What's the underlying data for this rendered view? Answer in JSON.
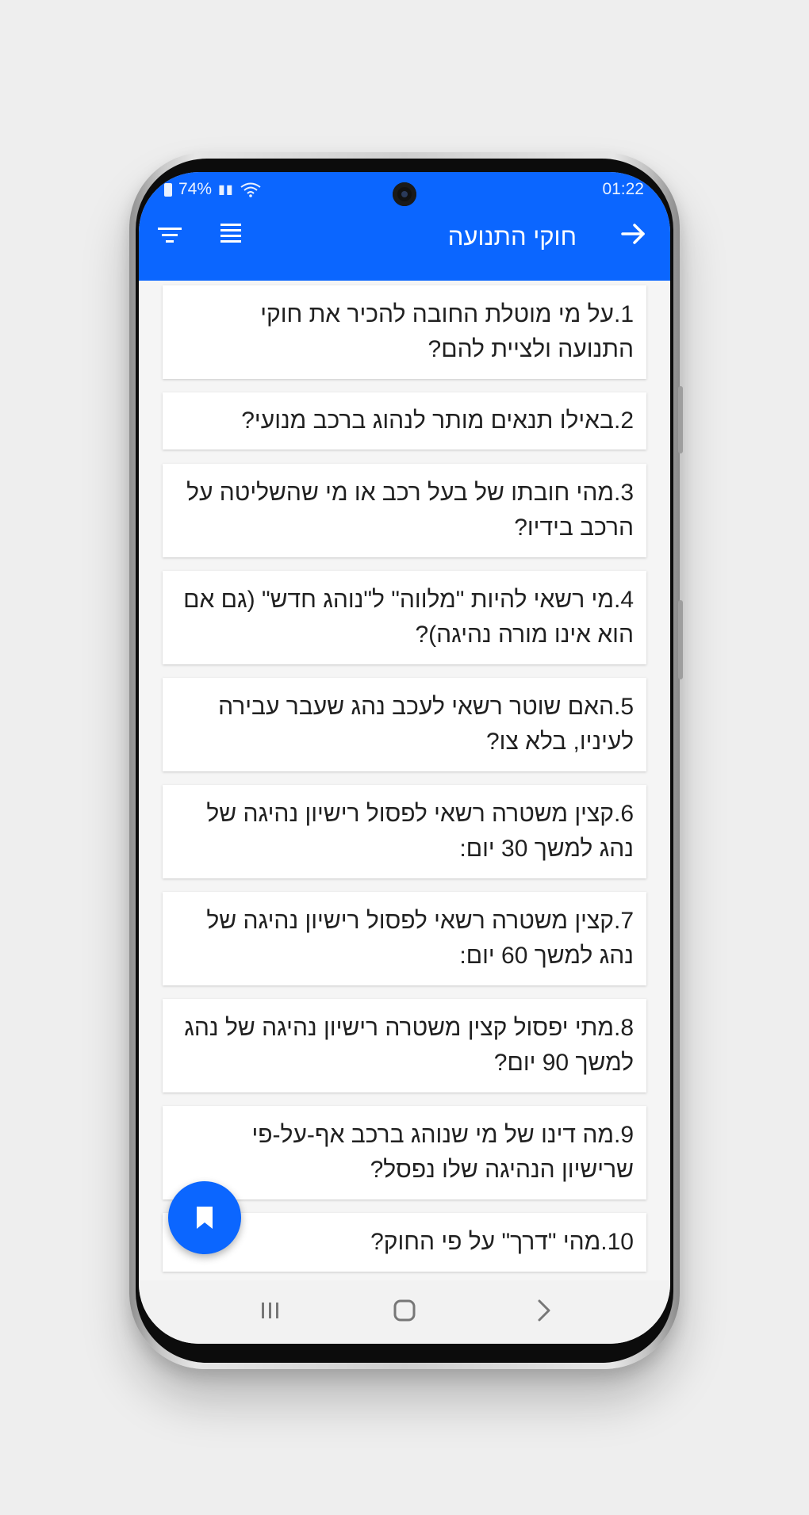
{
  "status_bar": {
    "battery": "74%",
    "time": "01:22"
  },
  "appbar": {
    "title": "חוקי התנועה",
    "icons": [
      "back-arrow-icon",
      "filter-icon",
      "list-icon"
    ]
  },
  "questions": [
    "1.על מי מוטלת החובה להכיר את חוקי התנועה ולציית להם?",
    "2.באילו תנאים מותר לנהוג ברכב מנועי?",
    "3.מהי חובתו של בעל רכב או מי שהשליטה על הרכב בידיו?",
    "4.מי רשאי להיות \"מלווה\" ל\"נוהג חדש\" (גם אם הוא אינו מורה נהיגה)?",
    "5.האם שוטר רשאי לעכב נהג שעבר עבירה לעיניו, בלא צו?",
    "6.קצין משטרה רשאי לפסול רישיון נהיגה של נהג למשך 30 יום:",
    "7.קצין משטרה רשאי לפסול רישיון נהיגה של נהג למשך 60 יום:",
    "8.מתי יפסול קצין משטרה רישיון נהיגה של נהג למשך 90 יום?",
    "9.מה דינו של מי שנוהג ברכב אף-על-פי שרישיון הנהיגה שלו נפסל?",
    "10.מהי \"דרך\" על פי החוק?"
  ],
  "fab": {
    "icon": "bookmark-icon"
  },
  "navbar": {
    "icons": [
      "recent-apps-icon",
      "home-icon",
      "back-icon"
    ]
  },
  "colors": {
    "primary": "#0b66ff",
    "background": "#f5f5f5"
  }
}
